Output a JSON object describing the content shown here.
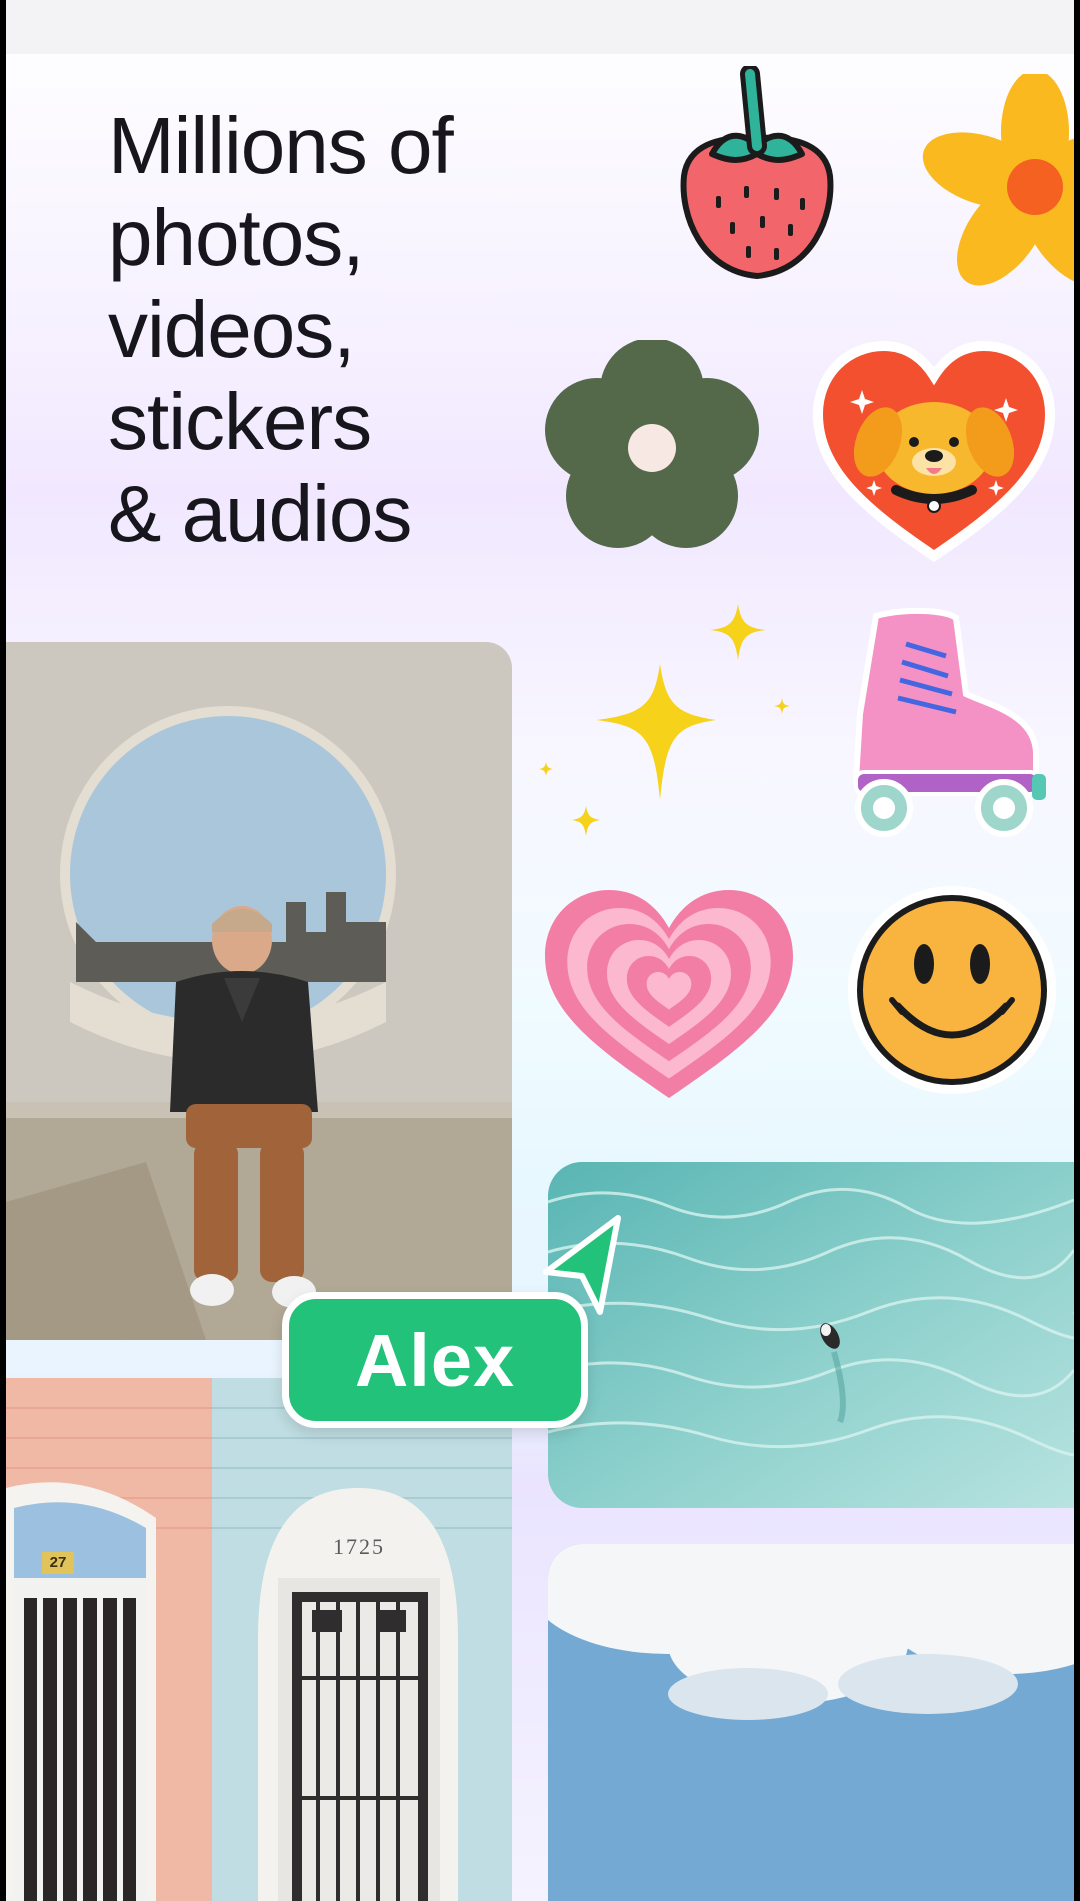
{
  "headline": {
    "lines": [
      "Millions of",
      "photos,",
      "videos,",
      "stickers",
      "& audios"
    ]
  },
  "collaborator": {
    "name": "Alex",
    "color": "#23c27b"
  },
  "building_photo": {
    "house_number": "1725",
    "unit_number": "27"
  },
  "stickers": [
    "strawberry-icon",
    "orange-flower-icon",
    "green-flower-icon",
    "dog-heart-icon",
    "sparkle-stars-icon",
    "roller-skate-icon",
    "pink-heart-icon",
    "smiley-face-icon"
  ],
  "colors": {
    "headline_text": "#17161c",
    "accent_green": "#23c27b"
  }
}
